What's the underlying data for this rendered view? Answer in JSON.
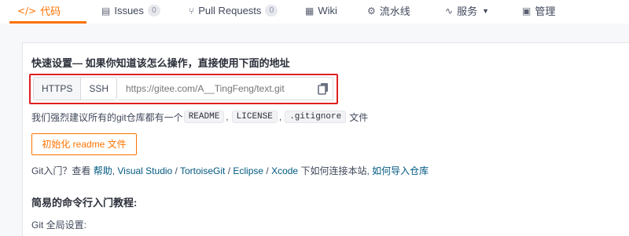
{
  "tabs": [
    {
      "icon": "</>",
      "label": "代码",
      "badge": null
    },
    {
      "icon": "▤",
      "label": "Issues",
      "badge": "0"
    },
    {
      "icon": "⑂",
      "label": "Pull Requests",
      "badge": "0"
    },
    {
      "icon": "▦",
      "label": "Wiki",
      "badge": null
    },
    {
      "icon": "⚙",
      "label": "流水线",
      "badge": null
    },
    {
      "icon": "∿",
      "label": "服务",
      "badge": null
    },
    {
      "icon": "▣",
      "label": "管理",
      "badge": null
    }
  ],
  "accent_color": "#fe7300",
  "quick_setup": {
    "title": "快速设置— 如果你知道该怎么操作，直接使用下面的地址",
    "https_label": "HTTPS",
    "ssh_label": "SSH",
    "url_placeholder": "https://gitee.com/A__TingFeng/text.git"
  },
  "suggest": {
    "prefix": "我们强烈建议所有的git仓库都有一个",
    "files": [
      "README",
      "LICENSE",
      ".gitignore"
    ],
    "suffix": "文件"
  },
  "init_button": "初始化 readme 文件",
  "git_help": {
    "prefix": "Git入门？查看",
    "help": "帮助",
    "links": [
      "Visual Studio",
      "TortoiseGit",
      "Eclipse",
      "Xcode"
    ],
    "middle": "下如何连接本站,",
    "import": "如何导入仓库"
  },
  "tutorial_title": "简易的命令行入门教程:",
  "git_global": "Git 全局设置:"
}
